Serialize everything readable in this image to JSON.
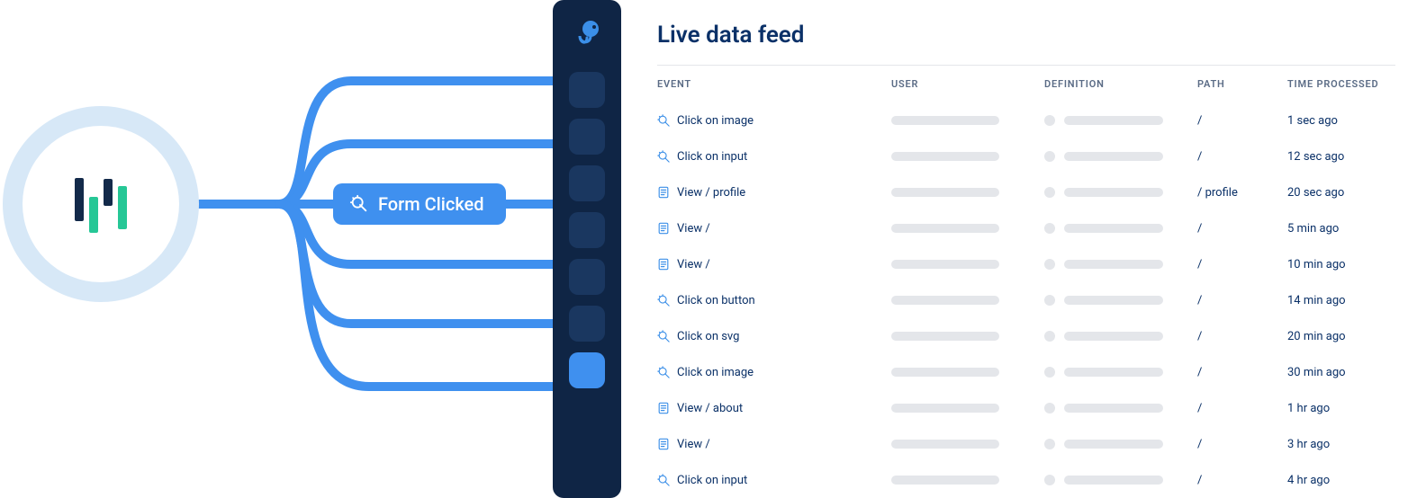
{
  "diagram": {
    "pill_label": "Form Clicked"
  },
  "feed": {
    "title": "Live data feed",
    "headers": {
      "event": "EVENT",
      "user": "USER",
      "definition": "DEFINITION",
      "path": "PATH",
      "time": "TIME PROCESSED"
    },
    "rows": [
      {
        "icon": "click",
        "event": "Click on image",
        "path": "/",
        "time": "1 sec ago"
      },
      {
        "icon": "click",
        "event": "Click on input",
        "path": "/",
        "time": "12 sec ago"
      },
      {
        "icon": "view",
        "event": "View / profile",
        "path": "/ profile",
        "time": "20 sec ago"
      },
      {
        "icon": "view",
        "event": "View /",
        "path": "/",
        "time": "5 min ago"
      },
      {
        "icon": "view",
        "event": "View /",
        "path": "/",
        "time": "10 min ago"
      },
      {
        "icon": "click",
        "event": "Click on button",
        "path": "/",
        "time": "14 min ago"
      },
      {
        "icon": "click",
        "event": "Click on svg",
        "path": "/",
        "time": "20 min ago"
      },
      {
        "icon": "click",
        "event": "Click on image",
        "path": "/",
        "time": "30 min ago"
      },
      {
        "icon": "view",
        "event": "View / about",
        "path": "/",
        "time": "1 hr ago"
      },
      {
        "icon": "view",
        "event": "View /",
        "path": "/",
        "time": "3 hr ago"
      },
      {
        "icon": "click",
        "event": "Click on input",
        "path": "/",
        "time": "4 hr ago"
      }
    ]
  }
}
